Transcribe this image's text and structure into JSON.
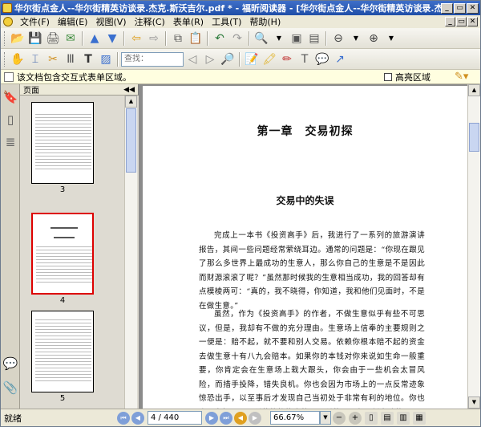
{
  "window": {
    "title": "华尔街点金人--华尔街精英访谈录.杰克.斯沃吉尔.pdf * - 福昕阅读器 - [华尔街点金人--华尔街精英访谈录.杰克.斯沃吉尔.pdf *]"
  },
  "menu": [
    "文件(F)",
    "编辑(E)",
    "视图(V)",
    "注释(C)",
    "表单(R)",
    "工具(T)",
    "帮助(H)"
  ],
  "toolbar": {
    "find_placeholder": "查找："
  },
  "infobar": {
    "message": "该文档包含交互式表单区域。",
    "highlight_label": "高亮区域"
  },
  "panel": {
    "title": "页面",
    "thumbnails": [
      {
        "label": "3"
      },
      {
        "label": "4"
      },
      {
        "label": "5"
      }
    ]
  },
  "document": {
    "chapter_title": "第一章　交易初探",
    "section_title": "交易中的失误",
    "paragraphs": [
      "完成上一本书《投资高手》后，我进行了一系列的旅游演讲报告，其间一些问题经常萦绕耳边。通常的问题是：“你现在跟见了那么多世界上最成功的生意人，那么你自己的生意是不是因此而财源滚滚了呢？”虽然那时候我的生意相当成功，我的回答却有点模棱两可：“真的，我不晓得，你知道，我和他们见面时，不是在做生意。”",
      "虽然，作为《投资高手》的作者，不做生意似乎有些不可思议，但是，我却有不做的充分理由。生意场上信奉的主要规则之一便是：赔不起，就不要和别人交易。依赖你根本赔不起的资金去做生意十有八九会赔本。如果你的本钱对你来说如生命一般重要，你肯定会在生意场上栽大跟头，你会由于一些机会太冒风险，而措手投降，错失良机。你也会因为市场上的一点反常迹象惊恐出手，以至事后才发现自己当初处于非常有利的地位。你也会因为担心一无所获的趋势真的一无所获，具有讽刺意味的是，"
    ]
  },
  "status": {
    "ready": "就绪",
    "page_value": "4 / 440",
    "zoom_value": "66.67%"
  },
  "colors": {
    "title_bar": "#1f4ea8",
    "selected_thumbnail_border": "#dd0000",
    "info_bar": "#fffee0"
  },
  "icons": {
    "sidebar": [
      "bookmark-icon",
      "pages-icon",
      "layers-icon",
      "comment-icon",
      "attachment-icon"
    ]
  }
}
